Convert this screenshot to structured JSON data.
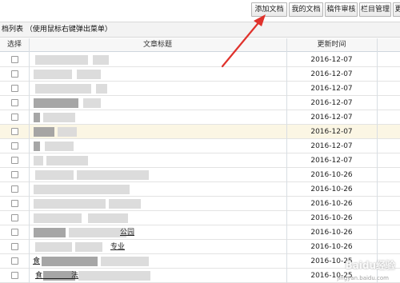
{
  "toolbar": {
    "buttons": [
      {
        "label": "添加文档"
      },
      {
        "label": "我的文档"
      },
      {
        "label": "稿件审核"
      },
      {
        "label": "栏目管理"
      },
      {
        "label": "更"
      }
    ]
  },
  "list": {
    "heading": "档列表 （使用鼠标右键弹出菜单）"
  },
  "table": {
    "columns": {
      "select": "选择",
      "title": "文章标题",
      "updated": "更新时间"
    },
    "rows": [
      {
        "title": "",
        "date": "2016-12-07",
        "highlight": false
      },
      {
        "title": "",
        "date": "2016-12-07",
        "highlight": false
      },
      {
        "title": "",
        "date": "2016-12-07",
        "highlight": false
      },
      {
        "title": "",
        "date": "2016-12-07",
        "highlight": false
      },
      {
        "title": "",
        "date": "2016-12-07",
        "highlight": false
      },
      {
        "title": "",
        "date": "2016-12-07",
        "highlight": true
      },
      {
        "title": "",
        "date": "2016-12-07",
        "highlight": false
      },
      {
        "title": "",
        "date": "2016-12-07",
        "highlight": false
      },
      {
        "title": "",
        "date": "2016-10-26",
        "highlight": false
      },
      {
        "title": "",
        "date": "2016-10-26",
        "highlight": false
      },
      {
        "title": "",
        "date": "2016-10-26",
        "highlight": false
      },
      {
        "title": "",
        "date": "2016-10-26",
        "highlight": false
      },
      {
        "title": "公园",
        "date": "2016-10-26",
        "highlight": false
      },
      {
        "title": "专业",
        "date": "2016-10-26",
        "highlight": false
      },
      {
        "title": "食",
        "date": "2016-10-25",
        "highlight": false
      },
      {
        "title": "食　　　　法",
        "date": "2016-10-25",
        "highlight": false
      }
    ]
  },
  "annotation": {
    "arrow_color": "#e0322c"
  },
  "watermark": {
    "text": "Baidu经验",
    "sub": "jingyan.baidu.com"
  }
}
